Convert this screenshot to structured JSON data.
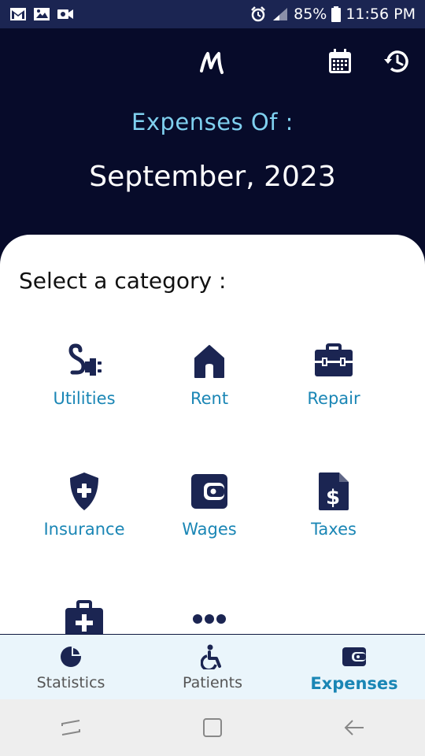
{
  "status_bar": {
    "battery": "85%",
    "time": "11:56 PM"
  },
  "header": {
    "expenses_of_label": "Expenses Of :",
    "month_label": "September, 2023"
  },
  "sheet": {
    "title": "Select a category :",
    "categories": [
      {
        "label": "Utilities",
        "icon": "plug-icon"
      },
      {
        "label": "Rent",
        "icon": "house-icon"
      },
      {
        "label": "Repair",
        "icon": "toolbox-icon"
      },
      {
        "label": "Insurance",
        "icon": "shield-plus-icon"
      },
      {
        "label": "Wages",
        "icon": "wallet-icon"
      },
      {
        "label": "Taxes",
        "icon": "dollar-document-icon"
      },
      {
        "label": "",
        "icon": "medical-kit-icon"
      },
      {
        "label": "",
        "icon": "more-dots-icon"
      }
    ]
  },
  "bottom_nav": {
    "items": [
      {
        "label": "Statistics",
        "icon": "pie-chart-icon"
      },
      {
        "label": "Patients",
        "icon": "wheelchair-icon"
      },
      {
        "label": "Expenses",
        "icon": "wallet-icon"
      }
    ],
    "active_index": 2
  },
  "colors": {
    "header_bg": "#070b2a",
    "accent": "#1a86b5",
    "subtitle": "#7fd0ef",
    "icon_dark": "#1b2552"
  }
}
